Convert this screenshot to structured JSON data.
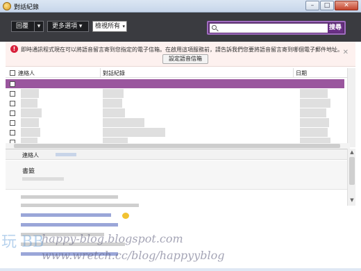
{
  "window": {
    "title": "對話紀錄",
    "buttons": {
      "minimize": "–",
      "maximize": "□",
      "close": "✕"
    }
  },
  "toolbar": {
    "reply_label": "回覆",
    "reply_dropdown": "▾",
    "more_label": "更多選項 ▾",
    "view_select_value": "檢視所有",
    "view_select_arrow": "▾",
    "search_placeholder": "",
    "search_button": "搜尋"
  },
  "info_bar": {
    "icon": "!",
    "message": "即時通訊程式現在可以將語音留言寄到您指定的電子信箱。在啟用這項服務前，請告訴我們您要將語音留言寄到哪個電子郵件地址。",
    "setup_button": "設定語音信箱",
    "close": "✕"
  },
  "list": {
    "columns": [
      "連絡人",
      "對話紀錄",
      "日期"
    ]
  },
  "preview": {
    "contact_label": "連絡人",
    "title": "書籤"
  },
  "scroll": {
    "up": "▲",
    "down": "▼"
  },
  "watermark": {
    "logo": "玩 BB",
    "line1": "happy-blog.blogspot.com",
    "line2": "www.wretch.cc/blog/happyyblog"
  },
  "colors": {
    "toolbar": "#3a3b40",
    "selected_row": "#9a569e",
    "search_accent": "#6a2f86",
    "info_bg": "#fdf1ef"
  }
}
